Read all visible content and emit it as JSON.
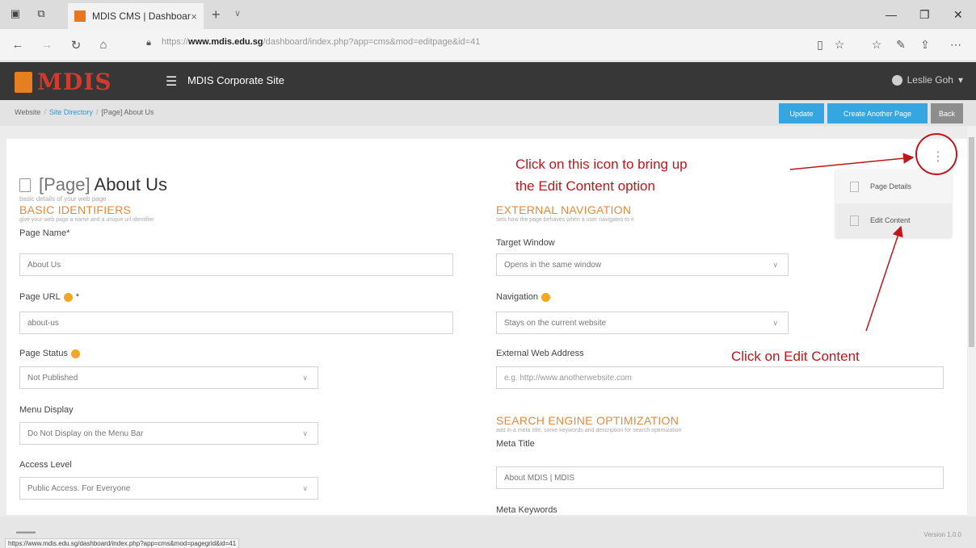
{
  "browser": {
    "tab_title": "MDIS CMS | Dashboard",
    "tab_close": "×",
    "new_tab": "+",
    "tab_dropdown": "∨",
    "url_prefix": "https://",
    "url_domain": "www.mdis.edu.sg",
    "url_path": "/dashboard/index.php?app=cms&mod=editpage&id=41",
    "status_url": "https://www.mdis.edu.sg/dashboard/index.php?app=cms&mod=pagegrid&id=41"
  },
  "header": {
    "logo_text": "MDIS",
    "site_name": "MDIS Corporate Site",
    "user_name": "Leslie Goh"
  },
  "breadcrumb": {
    "items": [
      "Website",
      "Site Directory",
      "[Page] About Us"
    ]
  },
  "toolbar": {
    "update_label": "Update",
    "create_another_label": "Create Another Page",
    "back_label": "Back"
  },
  "page": {
    "title_prefix": "[Page]",
    "title": "About Us",
    "subtitle": "basic details of your web page"
  },
  "basic": {
    "title": "BASIC IDENTIFIERS",
    "subtitle": "give your web page a name and a unique url identifier",
    "page_name_label": "Page Name*",
    "page_name_value": "About Us",
    "page_url_label": "Page URL",
    "page_url_star": "*",
    "page_url_value": "about-us",
    "page_status_label": "Page Status",
    "page_status_value": "Not Published",
    "menu_display_label": "Menu Display",
    "menu_display_value": "Do Not Display on the Menu Bar",
    "access_level_label": "Access Level",
    "access_level_value": "Public Access. For Everyone"
  },
  "external": {
    "title": "EXTERNAL NAVIGATION",
    "subtitle": "sets how the page behaves when a user navigates to it",
    "target_window_label": "Target Window",
    "target_window_value": "Opens in the same window",
    "navigation_label": "Navigation",
    "navigation_value": "Stays on the current website",
    "ext_address_label": "External Web Address",
    "ext_address_placeholder": "e.g. http://www.anotherwebsite.com"
  },
  "seo": {
    "title": "SEARCH ENGINE OPTIMIZATION",
    "subtitle": "add in a meta title, some keywords and description for search optimization",
    "meta_title_label": "Meta Title",
    "meta_title_value": "About MDIS | MDIS",
    "meta_keywords_label": "Meta Keywords"
  },
  "menu": {
    "page_details": "Page Details",
    "edit_content": "Edit Content"
  },
  "annotations": {
    "icon_line1": "Click on this icon to bring up",
    "icon_line2": "the Edit Content option",
    "edit_content": "Click on Edit Content",
    "color": "#c0151b"
  },
  "footer": {
    "version": "Version 1.0.0"
  }
}
